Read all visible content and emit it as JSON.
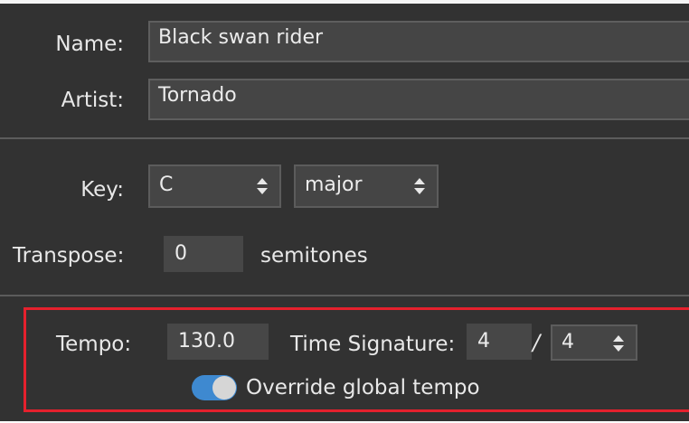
{
  "song": {
    "name_label": "Name:",
    "name_value": "Black swan rider",
    "artist_label": "Artist:",
    "artist_value": "Tornado"
  },
  "key": {
    "label": "Key:",
    "note": "C",
    "mode": "major",
    "transpose_label": "Transpose:",
    "transpose_value": "0",
    "transpose_unit": "semitones"
  },
  "tempo": {
    "label": "Tempo:",
    "value": "130.0",
    "time_signature_label": "Time Signature:",
    "numerator": "4",
    "separator": "/",
    "denominator": "4",
    "override_label": "Override global tempo",
    "override_enabled": true
  },
  "colors": {
    "panel_bg": "#323232",
    "highlight": "#e5212d",
    "toggle_on": "#3e89d0"
  }
}
